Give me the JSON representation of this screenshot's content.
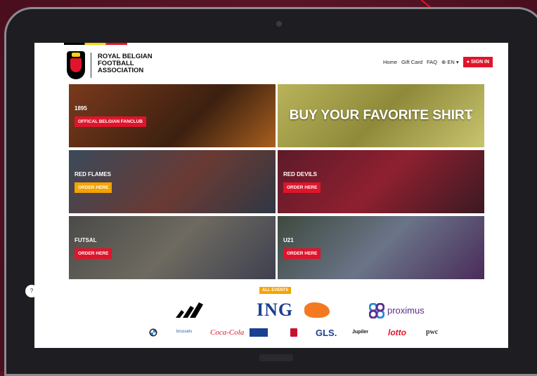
{
  "colors": {
    "accent": "#e0142b",
    "accent_yellow": "#f5a300",
    "background": "#5b1426"
  },
  "header": {
    "org_lines": [
      "ROYAL BELGIAN",
      "FOOTBALL",
      "ASSOCIATION"
    ],
    "nav": {
      "home": "Home",
      "gift_card": "Gift Card",
      "faq": "FAQ",
      "lang": "EN",
      "sign_in": "SIGN IN"
    }
  },
  "tiles": [
    {
      "title": "1895",
      "button": "OFFICAL BELGIAN FANCLUB"
    },
    {
      "title": "BUY YOUR FAVORITE SHIRT"
    },
    {
      "title": "RED FLAMES",
      "button": "ORDER HERE"
    },
    {
      "title": "RED DEVILS",
      "button": "ORDER HERE"
    },
    {
      "title": "FUTSAL",
      "button": "ORDER HERE"
    },
    {
      "title": "U21",
      "button": "ORDER HERE"
    }
  ],
  "all_events": "ALL EVENTS",
  "sponsors_main": {
    "ing": "ING",
    "proximus": "proximus"
  },
  "sponsors_small": [
    "brussels",
    "Coca-Cola",
    "GLS.",
    "Jupiler",
    "lotto",
    "pwc"
  ],
  "icons": [
    "globe-icon",
    "user-icon",
    "chevron-left-icon",
    "chevron-right-icon",
    "adidas-logo",
    "ing-lion-icon",
    "proximus-icon",
    "bmw-logo"
  ]
}
